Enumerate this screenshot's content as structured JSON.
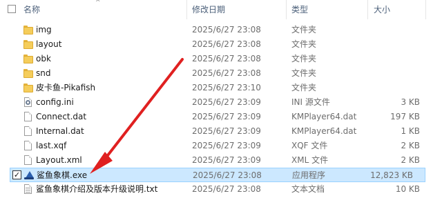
{
  "columns": {
    "name": "名称",
    "date": "修改日期",
    "type": "类型",
    "size": "大小"
  },
  "header": {
    "sort_caret": "^"
  },
  "files": [
    {
      "name": "img",
      "date": "2025/6/27 23:08",
      "type": "文件夹",
      "size": "",
      "icon": "folder-icon"
    },
    {
      "name": "layout",
      "date": "2025/6/27 23:08",
      "type": "文件夹",
      "size": "",
      "icon": "folder-icon"
    },
    {
      "name": "obk",
      "date": "2025/6/27 23:08",
      "type": "文件夹",
      "size": "",
      "icon": "folder-icon"
    },
    {
      "name": "snd",
      "date": "2025/6/27 23:08",
      "type": "文件夹",
      "size": "",
      "icon": "folder-icon"
    },
    {
      "name": "皮卡鱼-Pikafish",
      "date": "2025/6/27 23:10",
      "type": "文件夹",
      "size": "",
      "icon": "folder-icon"
    },
    {
      "name": "config.ini",
      "date": "2025/6/27 23:09",
      "type": "INI 源文件",
      "size": "3 KB",
      "icon": "settings-file-icon"
    },
    {
      "name": "Connect.dat",
      "date": "2025/6/27 23:09",
      "type": "KMPlayer64.dat",
      "size": "197 KB",
      "icon": "file-icon"
    },
    {
      "name": "Internal.dat",
      "date": "2025/6/27 23:09",
      "type": "KMPlayer64.dat",
      "size": "1 KB",
      "icon": "file-icon"
    },
    {
      "name": "last.xqf",
      "date": "2025/6/27 23:09",
      "type": "XQF 文件",
      "size": "2 KB",
      "icon": "file-icon"
    },
    {
      "name": "Layout.xml",
      "date": "2025/6/27 23:09",
      "type": "XML 文件",
      "size": "2 KB",
      "icon": "file-icon"
    },
    {
      "name": "鲨鱼象棋.exe",
      "date": "2025/6/27 23:08",
      "type": "应用程序",
      "size": "12,823 KB",
      "icon": "shark-app-icon",
      "selected": true,
      "checked": true,
      "check_mark": "✓"
    },
    {
      "name": "鲨鱼象棋介绍及版本升级说明.txt",
      "date": "2025/6/27 23:08",
      "type": "文本文档",
      "size": "10 KB",
      "icon": "text-file-icon"
    }
  ],
  "annotation_color": "#e02020"
}
